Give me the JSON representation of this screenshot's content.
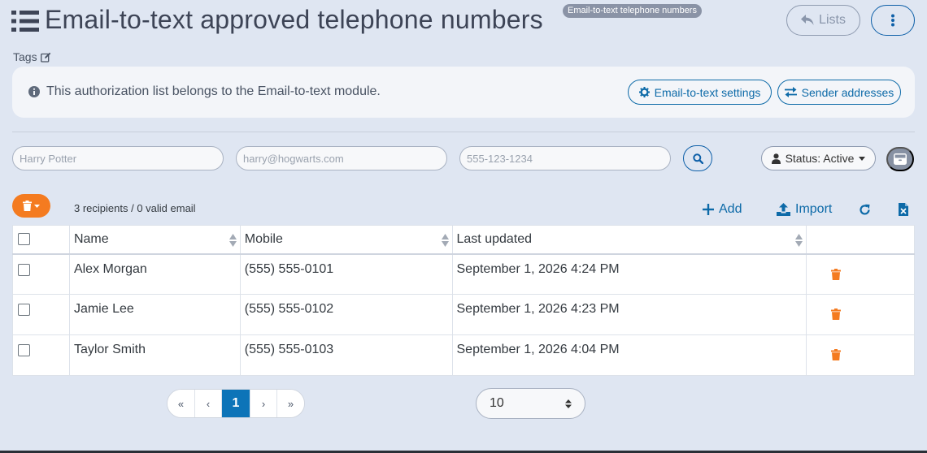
{
  "header": {
    "title": "Email-to-text approved telephone numbers",
    "badge": "Email-to-text telephone numbers",
    "lists_label": "Lists"
  },
  "tags_label": "Tags",
  "info": {
    "message": "This authorization list belongs to the Email-to-text module.",
    "settings_label": "Email-to-text settings",
    "senders_label": "Sender addresses"
  },
  "filters": {
    "name_placeholder": "Harry Potter",
    "email_placeholder": "harry@hogwarts.com",
    "phone_placeholder": "555-123-1234",
    "status_label": "Status: Active"
  },
  "toolbar": {
    "count_text": "3 recipients / 0 valid email",
    "add_label": "Add",
    "import_label": "Import"
  },
  "table": {
    "headers": {
      "name": "Name",
      "mobile": "Mobile",
      "updated": "Last updated"
    },
    "rows": [
      {
        "name": "Alex Morgan",
        "mobile": "(555) 555-0101",
        "updated": "September 1, 2026 4:24 PM"
      },
      {
        "name": "Jamie Lee",
        "mobile": "(555) 555-0102",
        "updated": "September 1, 2026 4:23 PM"
      },
      {
        "name": "Taylor Smith",
        "mobile": "(555) 555-0103",
        "updated": "September 1, 2026 4:04 PM"
      }
    ]
  },
  "pagination": {
    "first": "«",
    "prev": "‹",
    "current": "1",
    "next": "›",
    "last": "»",
    "page_size": "10"
  },
  "colors": {
    "accent": "#0d6aa8",
    "orange": "#f47b20",
    "background": "#dfe6f2"
  }
}
